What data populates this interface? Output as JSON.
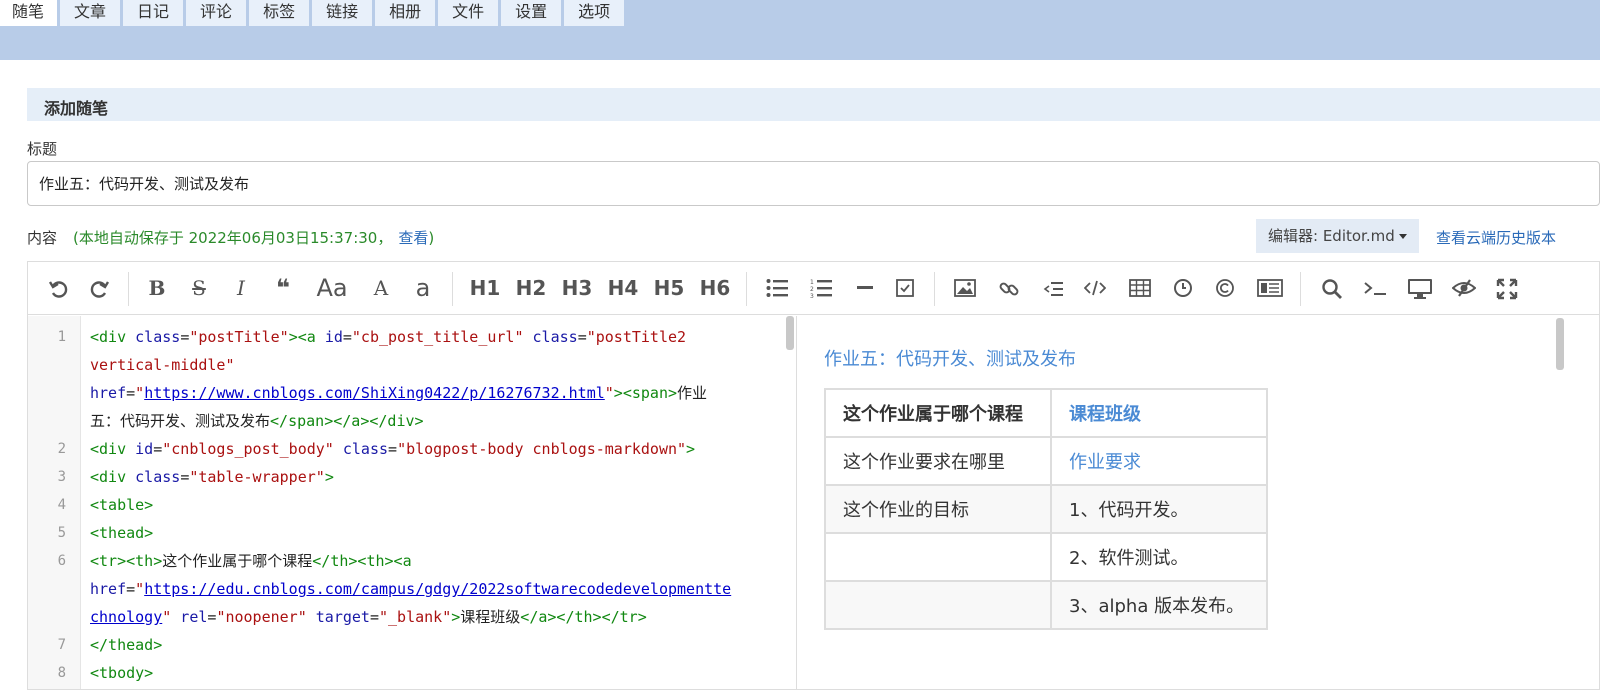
{
  "nav": {
    "tabs": [
      "随笔",
      "文章",
      "日记",
      "评论",
      "标签",
      "链接",
      "相册",
      "文件",
      "设置",
      "选项"
    ],
    "active_index": 0
  },
  "section": {
    "title": "添加随笔"
  },
  "form": {
    "title_label": "标题",
    "title_value": "作业五：代码开发、测试及发布",
    "content_label": "内容",
    "autosave_text": "(本地自动保存于 2022年06月03日15:37:30，",
    "autosave_link": "查看",
    "autosave_close": ")",
    "editor_select": "编辑器: Editor.md",
    "history_link": "查看云端历史版本"
  },
  "toolbar": {
    "undo_icon": "undo-icon",
    "redo_icon": "redo-icon",
    "bold": "B",
    "strike": "S",
    "italic": "I",
    "quote": "❝",
    "case_upper": "Aa",
    "case_a": "A",
    "case_lower": "a",
    "h1": "H1",
    "h2": "H2",
    "h3": "H3",
    "h4": "H4",
    "h5": "H5",
    "h6": "H6"
  },
  "code": {
    "line_numbers": [
      "1",
      "",
      "",
      "",
      "2",
      "3",
      "4",
      "5",
      "6",
      "",
      "",
      "7",
      "8"
    ],
    "l1a": "<div ",
    "l1b": "class",
    "l1c": "=",
    "l1d": "\"postTitle\"",
    "l1e": "><a ",
    "l1f": "id",
    "l1g": "\"cb_post_title_url\"",
    "l1h": " class",
    "l1i": "\"postTitle2",
    "l1j": "vertical-middle\"",
    "l1k": "href",
    "l1l": "\"",
    "l1m": "https://www.cnblogs.com/ShiXing0422/p/16276732.html",
    "l1n": "\"",
    "l1o": "><span>",
    "l1p": "作业",
    "l1q": "五：代码开发、测试及发布",
    "l1r": "</span></a></div>",
    "l2a": "<div ",
    "l2b": "id",
    "l2c": "\"cnblogs_post_body\"",
    "l2d": " class",
    "l2e": "\"blogpost-body cnblogs-markdown\"",
    "l2f": ">",
    "l3a": "<div ",
    "l3b": "class",
    "l3c": "\"table-wrapper\"",
    "l3d": ">",
    "l4": "<table>",
    "l5": "<thead>",
    "l6a": "<tr><th>",
    "l6b": "这个作业属于哪个课程",
    "l6c": "</th><th><a",
    "l6d": "href",
    "l6e": "\"",
    "l6f": "https://edu.cnblogs.com/campus/gdgy/2022softwarecodedevelopmentte",
    "l6g": "chnology",
    "l6h": "\"",
    "l6i": " rel",
    "l6j": "\"noopener\"",
    "l6k": " target",
    "l6l": "\"_blank\"",
    "l6m": ">",
    "l6n": "课程班级",
    "l6o": "</a></th></tr>",
    "l7": "</thead>",
    "l8": "<tbody>"
  },
  "preview": {
    "title": "作业五：代码开发、测试及发布",
    "header": [
      "这个作业属于哪个课程",
      "课程班级"
    ],
    "rows": [
      [
        "这个作业要求在哪里",
        "作业要求"
      ],
      [
        "这个作业的目标",
        "1、代码开发。"
      ],
      [
        "",
        "2、软件测试。"
      ],
      [
        "",
        "3、alpha 版本发布。"
      ]
    ]
  }
}
